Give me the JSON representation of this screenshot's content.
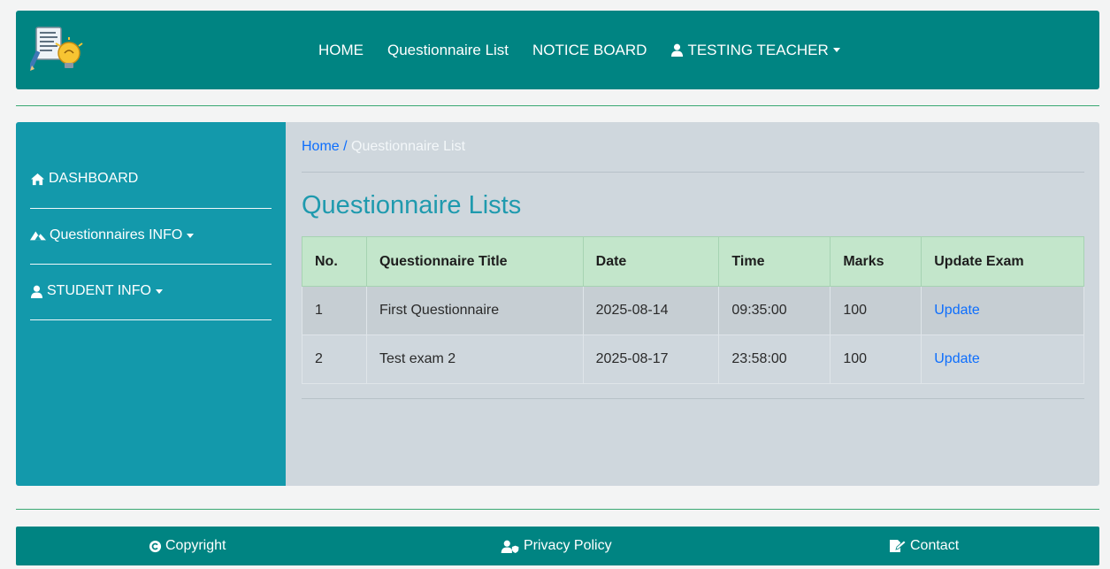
{
  "navbar": {
    "links": {
      "home": "HOME",
      "questionnaire_list": "Questionnaire List",
      "notice_board": "NOTICE BOARD",
      "user": "TESTING TEACHER"
    }
  },
  "sidebar": {
    "dashboard": "DASHBOARD",
    "questionnaires_info": "Questionnaires INFO",
    "student_info": "STUDENT INFO"
  },
  "breadcrumb": {
    "home": "Home",
    "separator": "/",
    "current": "Questionnaire List"
  },
  "page_title": "Questionnaire Lists",
  "table": {
    "headers": {
      "no": "No.",
      "title": "Questionnaire Title",
      "date": "Date",
      "time": "Time",
      "marks": "Marks",
      "update": "Update Exam"
    },
    "rows": [
      {
        "no": "1",
        "title": "First Questionnaire",
        "date": "2025-08-14",
        "time": "09:35:00",
        "marks": "100",
        "action": "Update"
      },
      {
        "no": "2",
        "title": "Test exam 2",
        "date": "2025-08-17",
        "time": "23:58:00",
        "marks": "100",
        "action": "Update"
      }
    ]
  },
  "footer": {
    "copyright": "Copyright",
    "privacy": "Privacy Policy",
    "contact": "Contact"
  },
  "icons": {
    "logo": "document-lightbulb-logo",
    "user": "user-icon",
    "home": "home-icon",
    "questionnaires": "mountain-icon",
    "copyright": "copyright-icon",
    "privacy": "user-shield-icon",
    "contact": "edit-file-icon"
  },
  "colors": {
    "navbar": "#008482",
    "sidebar": "#1399ab",
    "content_bg": "#cfd7dd",
    "table_header": "#c3e6cb",
    "link": "#0d6efd",
    "title": "#1f9aae"
  }
}
